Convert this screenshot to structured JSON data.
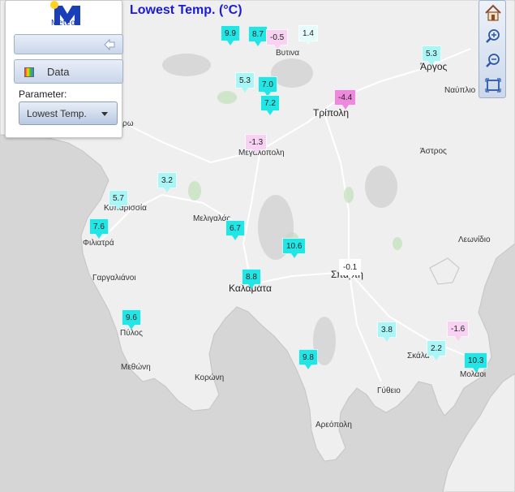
{
  "title": "Lowest Temp. (°C)",
  "logo_text": "Meteo",
  "panel": {
    "data_label": "Data",
    "parameter_label": "Parameter:",
    "parameter_value": "Lowest Temp."
  },
  "toolbar": [
    "home-icon",
    "zoom-in-icon",
    "zoom-out-icon",
    "extent-icon"
  ],
  "colors": {
    "land": "#efefef",
    "sea": "#d7d7d7",
    "warm": "#22e6e6",
    "mild": "#aaf5f5",
    "cool": "#e6fbfb",
    "neutral": "#ffffff",
    "cold": "#f8d2f2",
    "freezing": "#ee88dd",
    "accent": "#1a1adb"
  },
  "places": [
    {
      "name": "Βυτινα"
    },
    {
      "name": "Άργος"
    },
    {
      "name": "Ναύπλιο"
    },
    {
      "name": "Τρίπολη"
    },
    {
      "name": "Μεγαλόπολη"
    },
    {
      "name": "Άστρος"
    },
    {
      "name": "Κυπαρισσία"
    },
    {
      "name": "Μελιγαλάς"
    },
    {
      "name": "Φιλιατρά"
    },
    {
      "name": "Λεωνίδιο"
    },
    {
      "name": "Γαργαλιάνοι"
    },
    {
      "name": "Σπάρτη"
    },
    {
      "name": "Καλαμάτα"
    },
    {
      "name": "Πύλος"
    },
    {
      "name": "Σκάλα"
    },
    {
      "name": "Μολάοι"
    },
    {
      "name": "Μεθώνη"
    },
    {
      "name": "Κορώνη"
    },
    {
      "name": "Γύθειο"
    },
    {
      "name": "Αρεόπολη"
    },
    {
      "name": "ρω"
    }
  ],
  "stations": [
    {
      "value": "9.9",
      "tone": "warm"
    },
    {
      "value": "8.7",
      "tone": "warm"
    },
    {
      "value": "-0.5",
      "tone": "cold"
    },
    {
      "value": "1.4",
      "tone": "cool"
    },
    {
      "value": "5.3",
      "tone": "mild"
    },
    {
      "value": "5.3",
      "tone": "mild"
    },
    {
      "value": "7.0",
      "tone": "warm"
    },
    {
      "value": "7.2",
      "tone": "warm"
    },
    {
      "value": "-4.4",
      "tone": "freezing"
    },
    {
      "value": "-1.3",
      "tone": "cold"
    },
    {
      "value": "3.2",
      "tone": "mild"
    },
    {
      "value": "5.7",
      "tone": "mild"
    },
    {
      "value": "7.6",
      "tone": "warm"
    },
    {
      "value": "6.7",
      "tone": "warm"
    },
    {
      "value": "10.6",
      "tone": "warm"
    },
    {
      "value": "-0.1",
      "tone": "neutral"
    },
    {
      "value": "8.8",
      "tone": "warm"
    },
    {
      "value": "9.6",
      "tone": "warm"
    },
    {
      "value": "3.8",
      "tone": "mild"
    },
    {
      "value": "-1.6",
      "tone": "cold"
    },
    {
      "value": "2.2",
      "tone": "mild"
    },
    {
      "value": "10.3",
      "tone": "warm"
    },
    {
      "value": "9.8",
      "tone": "warm"
    }
  ]
}
